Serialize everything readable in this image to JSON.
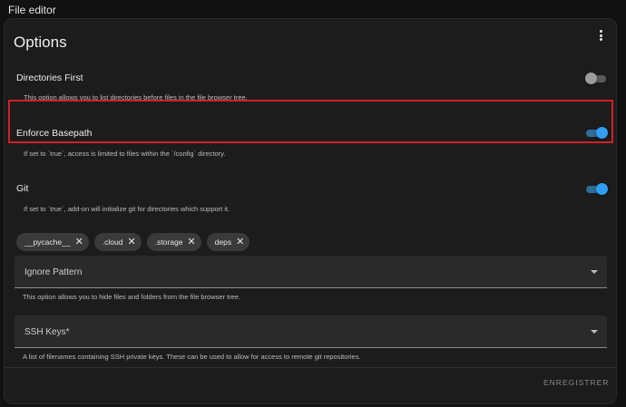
{
  "window": {
    "title": "File editor"
  },
  "card": {
    "title": "Options",
    "menu_icon": "more-vertical-icon"
  },
  "settings": [
    {
      "title": "Directories First",
      "description": "This option allows you to list directories before files in the file browser tree.",
      "enabled": false
    },
    {
      "title": "Enforce Basepath",
      "description": "If set to `true`, access is limited to files within the `/config` directory.",
      "enabled": true
    },
    {
      "title": "Git",
      "description": "If set to `true`, add-on will initialize git for directories which support it.",
      "enabled": true
    }
  ],
  "chips": [
    {
      "label": "__pycache__"
    },
    {
      "label": ".cloud"
    },
    {
      "label": ".storage"
    },
    {
      "label": "deps"
    }
  ],
  "ignore_pattern": {
    "label": "Ignore Pattern",
    "helper": "This option allows you to hide files and folders from the file browser tree."
  },
  "ssh_keys": {
    "label": "SSH Keys*",
    "helper": "A list of filenames containing SSH private keys. These can be used to allow for access to remote git repositories."
  },
  "actions": {
    "save_label": "ENREGISTRER"
  },
  "colors": {
    "highlight": "#d0202a",
    "toggle_on": "#2f9ef3"
  }
}
